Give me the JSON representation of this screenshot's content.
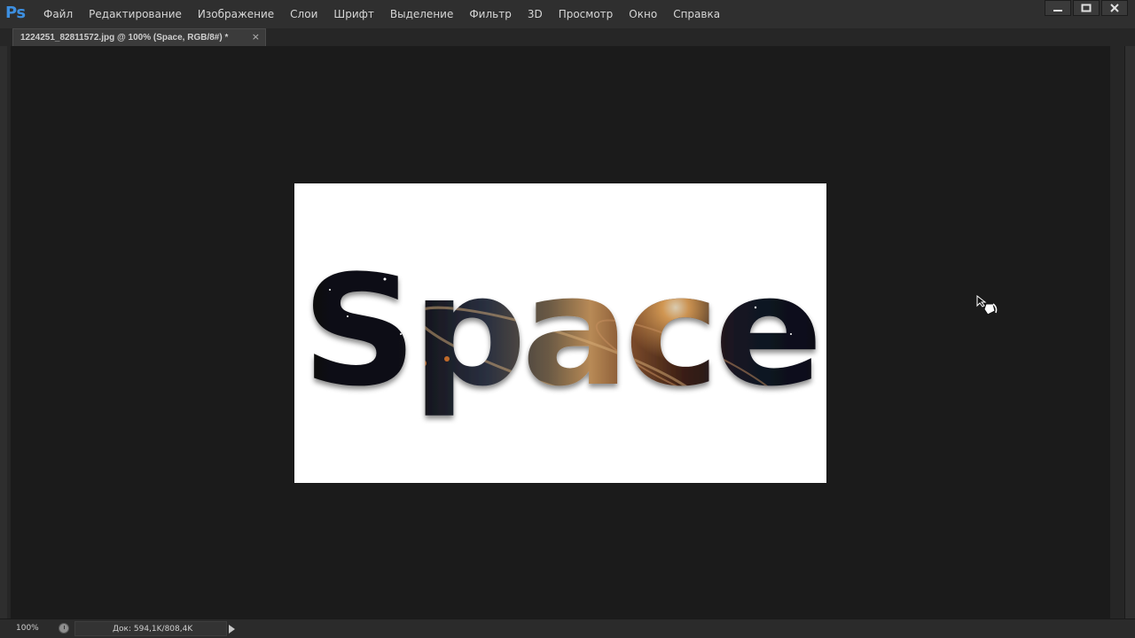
{
  "app": {
    "logo": "Ps",
    "menu": [
      "Файл",
      "Редактирование",
      "Изображение",
      "Слои",
      "Шрифт",
      "Выделение",
      "Фильтр",
      "3D",
      "Просмотр",
      "Окно",
      "Справка"
    ],
    "window_controls": [
      "minimize-icon",
      "maximize-icon",
      "close-icon"
    ]
  },
  "document_tab": {
    "title": "1224251_82811572.jpg @ 100% (Space, RGB/8#) *",
    "close": "×"
  },
  "canvas": {
    "text": "Space",
    "background": "#ffffff"
  },
  "status": {
    "zoom": "100%",
    "doc_size": "Док: 594,1K/808,4K"
  },
  "colors": {
    "logo_blue": "#3d8fe0",
    "workspace": "#1b1b1b",
    "menubar": "#2f2f2f"
  }
}
